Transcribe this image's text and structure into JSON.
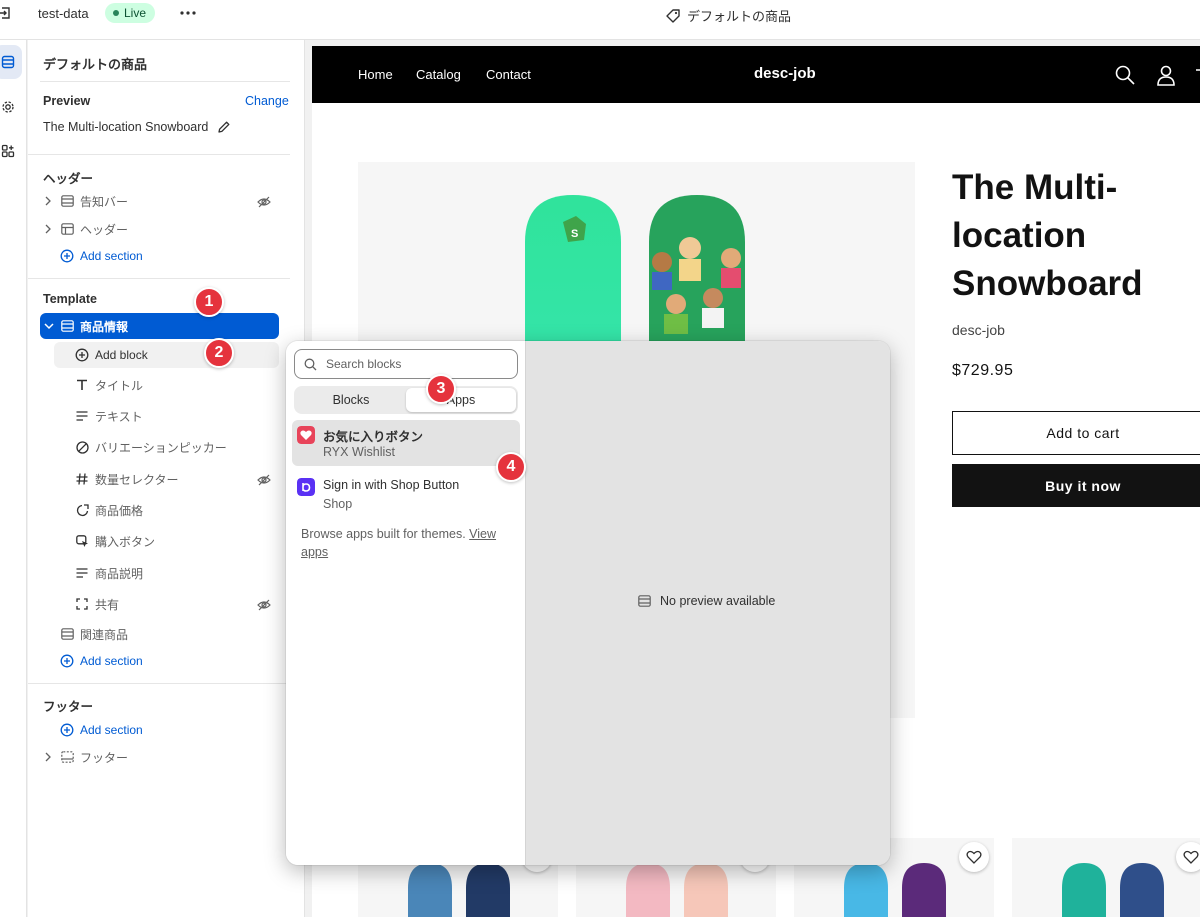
{
  "topbar": {
    "store_name": "test-data",
    "live_badge": "Live",
    "template_title": "デフォルトの商品"
  },
  "panel": {
    "title": "デフォルトの商品",
    "preview_heading": "Preview",
    "change_label": "Change",
    "preview_product": "The Multi-location Snowboard",
    "header_group": {
      "heading": "ヘッダー",
      "items": [
        {
          "label": "告知バー",
          "hidden": true
        },
        {
          "label": "ヘッダー",
          "hidden": false
        }
      ],
      "add_section": "Add section"
    },
    "template_group": {
      "heading": "Template",
      "selected_section": "商品情報",
      "add_block": "Add block",
      "blocks": [
        {
          "label": "タイトル",
          "icon": "title-icon",
          "hidden": false
        },
        {
          "label": "テキスト",
          "icon": "text-icon",
          "hidden": false
        },
        {
          "label": "バリエーションピッカー",
          "icon": "variant-picker-icon",
          "hidden": false
        },
        {
          "label": "数量セレクター",
          "icon": "quantity-icon",
          "hidden": true
        },
        {
          "label": "商品価格",
          "icon": "price-tag-icon",
          "hidden": false
        },
        {
          "label": "購入ボタン",
          "icon": "cursor-click-icon",
          "hidden": false
        },
        {
          "label": "商品説明",
          "icon": "description-icon",
          "hidden": false
        },
        {
          "label": "共有",
          "icon": "share-icon",
          "hidden": true
        }
      ],
      "related_section": "関連商品",
      "add_section": "Add section"
    },
    "footer_group": {
      "heading": "フッター",
      "add_section": "Add section",
      "items": [
        {
          "label": "フッター"
        }
      ]
    }
  },
  "steps": [
    "1",
    "2",
    "3",
    "4"
  ],
  "picker": {
    "search_placeholder": "Search blocks",
    "tabs": [
      {
        "label": "Blocks",
        "active": false
      },
      {
        "label": "Apps",
        "active": true
      }
    ],
    "apps": [
      {
        "name": "お気に入りボタン",
        "vendor": "RYX Wishlist",
        "icon_color": "#e8445a"
      },
      {
        "name": "Sign in with Shop Button",
        "vendor": "Shop",
        "icon_color": "#5a31f4"
      }
    ],
    "browse_text": "Browse apps built for themes.",
    "browse_link": "View apps",
    "no_preview": "No preview available"
  },
  "store": {
    "nav": [
      "Home",
      "Catalog",
      "Contact"
    ],
    "logo": "desc-job",
    "product": {
      "title": "The Multi-location Snowboard",
      "vendor": "desc-job",
      "price": "$729.95",
      "add_to_cart": "Add to cart",
      "buy_now": "Buy it now"
    }
  },
  "colors": {
    "accent": "#005bd3",
    "live_bg": "#cdfee1",
    "step_badge": "#e5333d"
  }
}
